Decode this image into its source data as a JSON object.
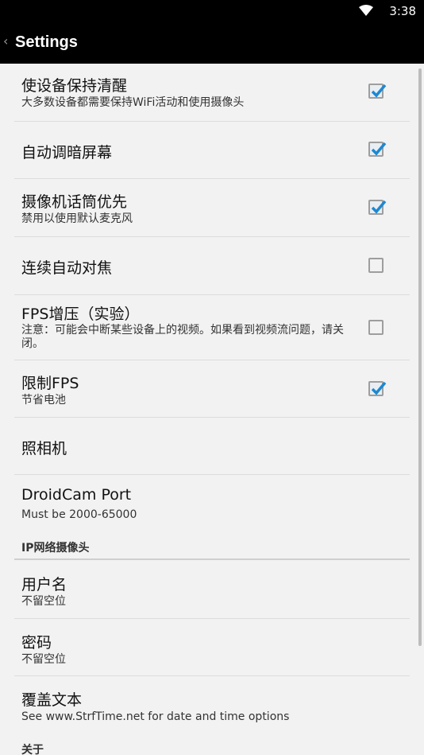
{
  "status_bar": {
    "time": "3:38"
  },
  "app_bar": {
    "back_glyph": "‹",
    "title": "Settings"
  },
  "prefs": [
    {
      "title": "使设备保持清醒",
      "summary": "大多数设备都需要保持WiFi活动和使用摄像头",
      "checked": true
    },
    {
      "title": "自动调暗屏幕",
      "summary": "",
      "checked": true
    },
    {
      "title": "摄像机话筒优先",
      "summary": "禁用以使用默认麦克风",
      "checked": true
    },
    {
      "title": "连续自动对焦",
      "summary": "",
      "checked": false
    },
    {
      "title": "FPS增压（实验）",
      "summary": "注意：可能会中断某些设备上的视频。如果看到视频流问题，请关闭。",
      "checked": false
    },
    {
      "title": "限制FPS",
      "summary": "节省电池",
      "checked": true
    },
    {
      "title": "照相机",
      "summary": ""
    },
    {
      "title": "DroidCam Port",
      "summary": "Must be 2000-65000"
    }
  ],
  "category_ip": "IP网络摄像头",
  "ip_prefs": [
    {
      "title": "用户名",
      "summary": "不留空位"
    },
    {
      "title": "密码",
      "summary": "不留空位"
    },
    {
      "title": "覆盖文本",
      "summary": "See www.StrfTime.net for date and time options"
    }
  ],
  "category_about": "关于",
  "colors": {
    "check_accent": "#1e88d2",
    "app_bar_bg": "#000000",
    "list_bg": "#f2f2f2"
  }
}
